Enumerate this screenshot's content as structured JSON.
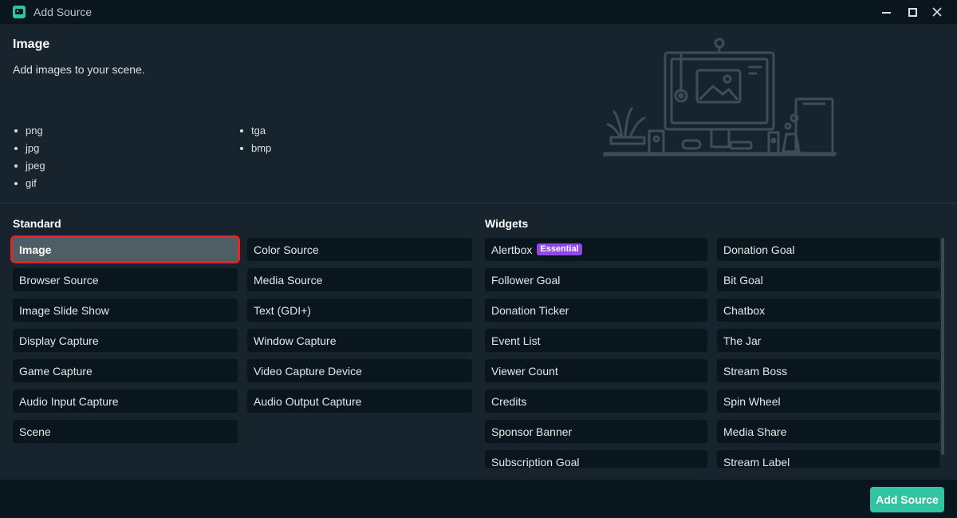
{
  "window": {
    "title": "Add Source",
    "controls": [
      "minimize-icon",
      "maximize-icon",
      "close-icon"
    ]
  },
  "info": {
    "title": "Image",
    "description": "Add images to your scene.",
    "formats_col1": [
      "png",
      "jpg",
      "jpeg",
      "gif"
    ],
    "formats_col2": [
      "tga",
      "bmp"
    ]
  },
  "standard": {
    "title": "Standard",
    "col1": [
      "Image",
      "Browser Source",
      "Image Slide Show",
      "Display Capture",
      "Game Capture",
      "Audio Input Capture",
      "Scene"
    ],
    "col2": [
      "Color Source",
      "Media Source",
      "Text (GDI+)",
      "Window Capture",
      "Video Capture Device",
      "Audio Output Capture"
    ],
    "selected": "Image"
  },
  "widgets": {
    "title": "Widgets",
    "col1": [
      "Alertbox",
      "Follower Goal",
      "Donation Ticker",
      "Event List",
      "Viewer Count",
      "Credits",
      "Sponsor Banner",
      "Subscription Goal"
    ],
    "col2": [
      "Donation Goal",
      "Bit Goal",
      "Chatbox",
      "The Jar",
      "Stream Boss",
      "Spin Wheel",
      "Media Share",
      "Stream Label"
    ],
    "badge": "Essential"
  },
  "footer": {
    "add_label": "Add Source"
  },
  "colors": {
    "background": "#17242d",
    "titlebar": "#09161d",
    "item": "#09161d",
    "selected": "#4f5e65",
    "highlight": "#e0252b",
    "accent": "#31c3a2",
    "badge": "#9146e8"
  }
}
